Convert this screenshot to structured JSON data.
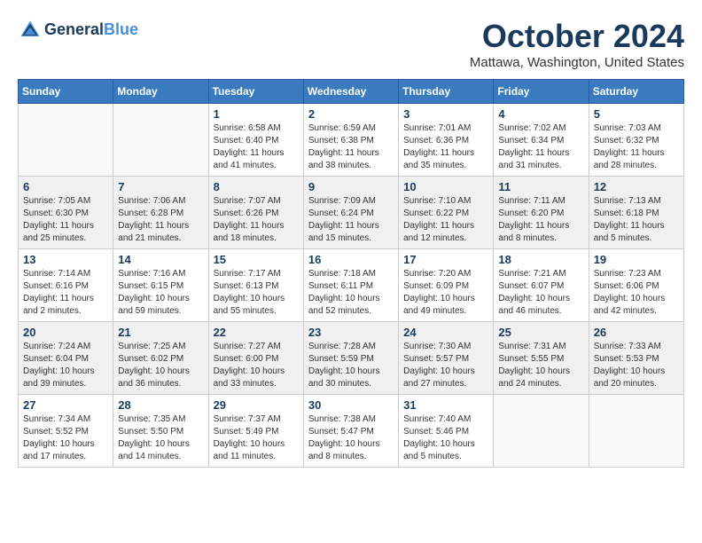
{
  "header": {
    "logo_line1": "General",
    "logo_line2": "Blue",
    "month": "October 2024",
    "location": "Mattawa, Washington, United States"
  },
  "weekdays": [
    "Sunday",
    "Monday",
    "Tuesday",
    "Wednesday",
    "Thursday",
    "Friday",
    "Saturday"
  ],
  "weeks": [
    [
      {
        "day": "",
        "info": ""
      },
      {
        "day": "",
        "info": ""
      },
      {
        "day": "1",
        "info": "Sunrise: 6:58 AM\nSunset: 6:40 PM\nDaylight: 11 hours and 41 minutes."
      },
      {
        "day": "2",
        "info": "Sunrise: 6:59 AM\nSunset: 6:38 PM\nDaylight: 11 hours and 38 minutes."
      },
      {
        "day": "3",
        "info": "Sunrise: 7:01 AM\nSunset: 6:36 PM\nDaylight: 11 hours and 35 minutes."
      },
      {
        "day": "4",
        "info": "Sunrise: 7:02 AM\nSunset: 6:34 PM\nDaylight: 11 hours and 31 minutes."
      },
      {
        "day": "5",
        "info": "Sunrise: 7:03 AM\nSunset: 6:32 PM\nDaylight: 11 hours and 28 minutes."
      }
    ],
    [
      {
        "day": "6",
        "info": "Sunrise: 7:05 AM\nSunset: 6:30 PM\nDaylight: 11 hours and 25 minutes."
      },
      {
        "day": "7",
        "info": "Sunrise: 7:06 AM\nSunset: 6:28 PM\nDaylight: 11 hours and 21 minutes."
      },
      {
        "day": "8",
        "info": "Sunrise: 7:07 AM\nSunset: 6:26 PM\nDaylight: 11 hours and 18 minutes."
      },
      {
        "day": "9",
        "info": "Sunrise: 7:09 AM\nSunset: 6:24 PM\nDaylight: 11 hours and 15 minutes."
      },
      {
        "day": "10",
        "info": "Sunrise: 7:10 AM\nSunset: 6:22 PM\nDaylight: 11 hours and 12 minutes."
      },
      {
        "day": "11",
        "info": "Sunrise: 7:11 AM\nSunset: 6:20 PM\nDaylight: 11 hours and 8 minutes."
      },
      {
        "day": "12",
        "info": "Sunrise: 7:13 AM\nSunset: 6:18 PM\nDaylight: 11 hours and 5 minutes."
      }
    ],
    [
      {
        "day": "13",
        "info": "Sunrise: 7:14 AM\nSunset: 6:16 PM\nDaylight: 11 hours and 2 minutes."
      },
      {
        "day": "14",
        "info": "Sunrise: 7:16 AM\nSunset: 6:15 PM\nDaylight: 10 hours and 59 minutes."
      },
      {
        "day": "15",
        "info": "Sunrise: 7:17 AM\nSunset: 6:13 PM\nDaylight: 10 hours and 55 minutes."
      },
      {
        "day": "16",
        "info": "Sunrise: 7:18 AM\nSunset: 6:11 PM\nDaylight: 10 hours and 52 minutes."
      },
      {
        "day": "17",
        "info": "Sunrise: 7:20 AM\nSunset: 6:09 PM\nDaylight: 10 hours and 49 minutes."
      },
      {
        "day": "18",
        "info": "Sunrise: 7:21 AM\nSunset: 6:07 PM\nDaylight: 10 hours and 46 minutes."
      },
      {
        "day": "19",
        "info": "Sunrise: 7:23 AM\nSunset: 6:06 PM\nDaylight: 10 hours and 42 minutes."
      }
    ],
    [
      {
        "day": "20",
        "info": "Sunrise: 7:24 AM\nSunset: 6:04 PM\nDaylight: 10 hours and 39 minutes."
      },
      {
        "day": "21",
        "info": "Sunrise: 7:25 AM\nSunset: 6:02 PM\nDaylight: 10 hours and 36 minutes."
      },
      {
        "day": "22",
        "info": "Sunrise: 7:27 AM\nSunset: 6:00 PM\nDaylight: 10 hours and 33 minutes."
      },
      {
        "day": "23",
        "info": "Sunrise: 7:28 AM\nSunset: 5:59 PM\nDaylight: 10 hours and 30 minutes."
      },
      {
        "day": "24",
        "info": "Sunrise: 7:30 AM\nSunset: 5:57 PM\nDaylight: 10 hours and 27 minutes."
      },
      {
        "day": "25",
        "info": "Sunrise: 7:31 AM\nSunset: 5:55 PM\nDaylight: 10 hours and 24 minutes."
      },
      {
        "day": "26",
        "info": "Sunrise: 7:33 AM\nSunset: 5:53 PM\nDaylight: 10 hours and 20 minutes."
      }
    ],
    [
      {
        "day": "27",
        "info": "Sunrise: 7:34 AM\nSunset: 5:52 PM\nDaylight: 10 hours and 17 minutes."
      },
      {
        "day": "28",
        "info": "Sunrise: 7:35 AM\nSunset: 5:50 PM\nDaylight: 10 hours and 14 minutes."
      },
      {
        "day": "29",
        "info": "Sunrise: 7:37 AM\nSunset: 5:49 PM\nDaylight: 10 hours and 11 minutes."
      },
      {
        "day": "30",
        "info": "Sunrise: 7:38 AM\nSunset: 5:47 PM\nDaylight: 10 hours and 8 minutes."
      },
      {
        "day": "31",
        "info": "Sunrise: 7:40 AM\nSunset: 5:46 PM\nDaylight: 10 hours and 5 minutes."
      },
      {
        "day": "",
        "info": ""
      },
      {
        "day": "",
        "info": ""
      }
    ]
  ]
}
